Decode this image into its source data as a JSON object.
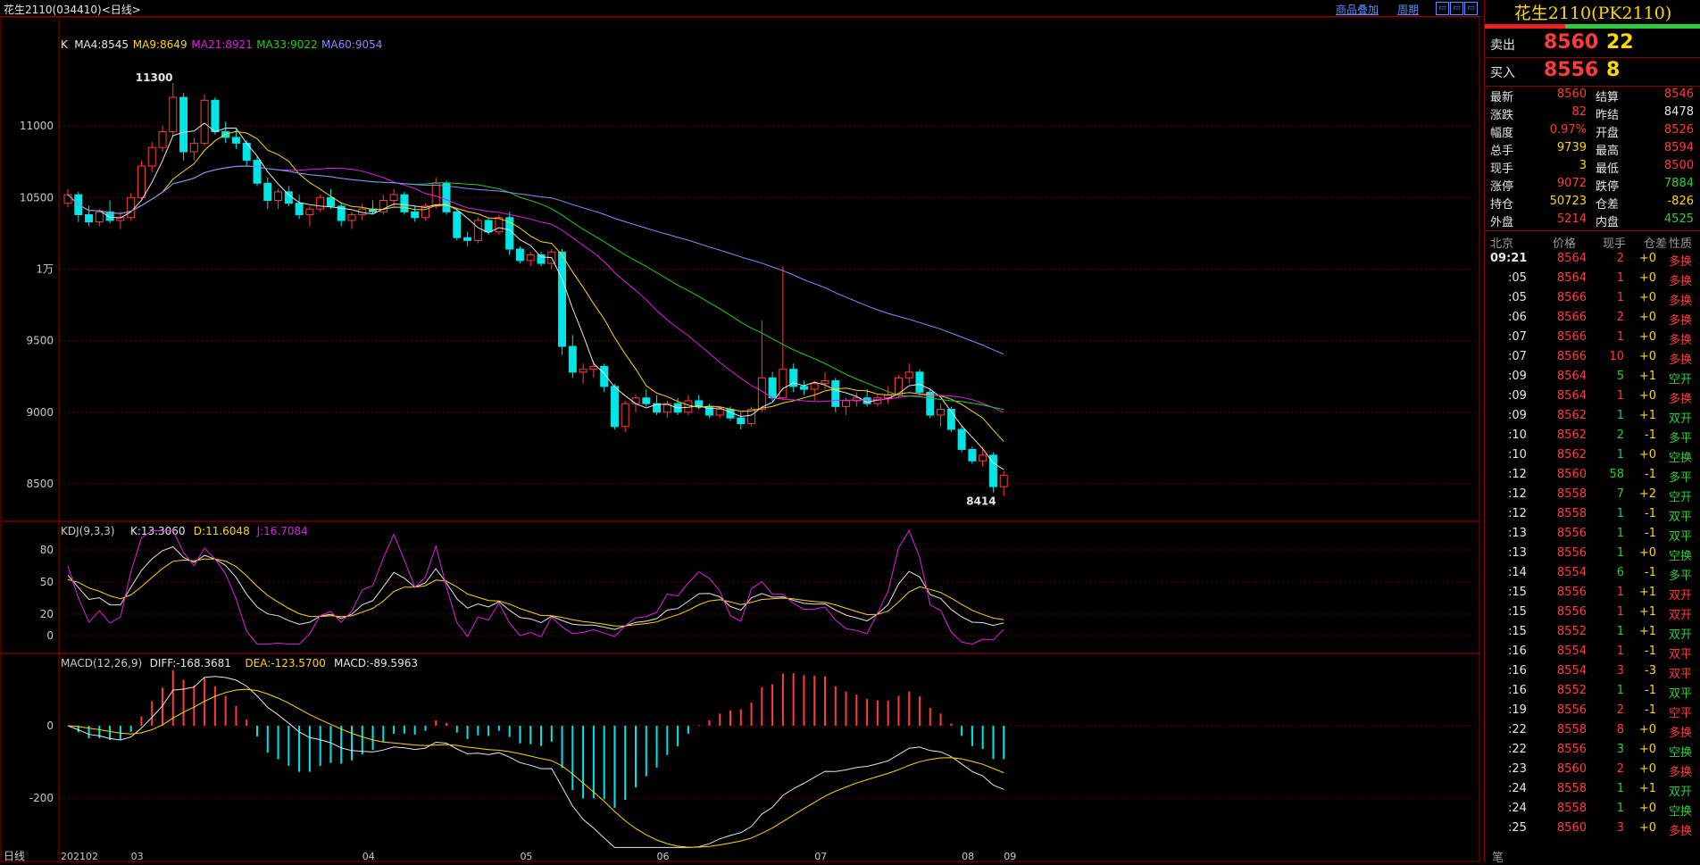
{
  "window": {
    "title": "花生2110(034410)<日线>",
    "links": {
      "overlay": "商品叠加",
      "period": "周期"
    },
    "win_buttons": [
      "▭",
      "▭",
      "▭"
    ]
  },
  "chart_data": {
    "type": "candlestick",
    "x_months": [
      "202102",
      "03",
      "04",
      "05",
      "06",
      "07",
      "08",
      "09"
    ],
    "bottom_label": "日线",
    "price_axis": {
      "ticks": [
        "11000",
        "10500",
        "1万",
        "9500",
        "9000",
        "8500"
      ],
      "range": [
        8300,
        11450
      ]
    },
    "ma_legend": [
      {
        "text": "K",
        "color": "#e6e6e6"
      },
      {
        "text": "MA4:8545",
        "color": "#e6e6e6"
      },
      {
        "text": "MA9:8649",
        "color": "#ffd700"
      },
      {
        "text": "MA21:8921",
        "color": "#e020e0"
      },
      {
        "text": "MA33:9022",
        "color": "#22cc22"
      },
      {
        "text": "MA60:9054",
        "color": "#8a8aff"
      }
    ],
    "high_mark": "11300",
    "low_mark": "8414",
    "candles": [
      [
        10460,
        10560,
        10430,
        10520
      ],
      [
        10520,
        10540,
        10330,
        10380
      ],
      [
        10380,
        10440,
        10300,
        10330
      ],
      [
        10330,
        10420,
        10300,
        10400
      ],
      [
        10400,
        10480,
        10320,
        10340
      ],
      [
        10340,
        10400,
        10280,
        10360
      ],
      [
        10360,
        10530,
        10340,
        10500
      ],
      [
        10500,
        10760,
        10480,
        10720
      ],
      [
        10720,
        10890,
        10680,
        10850
      ],
      [
        10850,
        11000,
        10820,
        10960
      ],
      [
        10960,
        11300,
        10930,
        11200
      ],
      [
        11200,
        11230,
        10760,
        10820
      ],
      [
        10820,
        10920,
        10760,
        10880
      ],
      [
        10880,
        11220,
        10860,
        11180
      ],
      [
        11180,
        11200,
        10940,
        10960
      ],
      [
        10960,
        11030,
        10880,
        10920
      ],
      [
        10920,
        10980,
        10840,
        10880
      ],
      [
        10880,
        10900,
        10720,
        10760
      ],
      [
        10760,
        10790,
        10580,
        10600
      ],
      [
        10600,
        10640,
        10420,
        10480
      ],
      [
        10480,
        10560,
        10420,
        10540
      ],
      [
        10540,
        10580,
        10440,
        10460
      ],
      [
        10460,
        10520,
        10350,
        10380
      ],
      [
        10380,
        10440,
        10300,
        10420
      ],
      [
        10420,
        10520,
        10400,
        10500
      ],
      [
        10500,
        10560,
        10420,
        10440
      ],
      [
        10440,
        10460,
        10300,
        10340
      ],
      [
        10340,
        10400,
        10280,
        10380
      ],
      [
        10380,
        10460,
        10340,
        10420
      ],
      [
        10420,
        10480,
        10380,
        10400
      ],
      [
        10400,
        10520,
        10380,
        10480
      ],
      [
        10480,
        10560,
        10440,
        10520
      ],
      [
        10520,
        10540,
        10380,
        10400
      ],
      [
        10400,
        10440,
        10330,
        10360
      ],
      [
        10360,
        10460,
        10340,
        10440
      ],
      [
        10440,
        10640,
        10420,
        10600
      ],
      [
        10600,
        10620,
        10380,
        10400
      ],
      [
        10400,
        10420,
        10200,
        10220
      ],
      [
        10220,
        10260,
        10160,
        10200
      ],
      [
        10200,
        10360,
        10180,
        10340
      ],
      [
        10340,
        10360,
        10240,
        10260
      ],
      [
        10260,
        10380,
        10240,
        10360
      ],
      [
        10360,
        10400,
        10100,
        10140
      ],
      [
        10140,
        10160,
        10040,
        10060
      ],
      [
        10060,
        10120,
        10020,
        10100
      ],
      [
        10100,
        10120,
        10020,
        10040
      ],
      [
        10040,
        10140,
        10000,
        10120
      ],
      [
        10120,
        10140,
        9400,
        9460
      ],
      [
        9460,
        9540,
        9240,
        9280
      ],
      [
        9280,
        9340,
        9200,
        9300
      ],
      [
        9300,
        9360,
        9240,
        9320
      ],
      [
        9320,
        9340,
        9140,
        9180
      ],
      [
        9180,
        9200,
        8880,
        8900
      ],
      [
        8900,
        9080,
        8860,
        9060
      ],
      [
        9060,
        9120,
        9000,
        9100
      ],
      [
        9100,
        9160,
        9040,
        9060
      ],
      [
        9060,
        9120,
        8980,
        9000
      ],
      [
        9000,
        9080,
        8960,
        9060
      ],
      [
        9060,
        9100,
        8980,
        9000
      ],
      [
        9000,
        9120,
        8980,
        9080
      ],
      [
        9080,
        9120,
        9020,
        9040
      ],
      [
        9040,
        9060,
        8960,
        8980
      ],
      [
        8980,
        9040,
        8960,
        9020
      ],
      [
        9020,
        9040,
        8940,
        8960
      ],
      [
        8960,
        9000,
        8880,
        8920
      ],
      [
        8920,
        9040,
        8900,
        9020
      ],
      [
        9020,
        9640,
        9000,
        9240
      ],
      [
        9240,
        9280,
        9080,
        9100
      ],
      [
        9100,
        10020,
        9080,
        9300
      ],
      [
        9300,
        9340,
        9140,
        9180
      ],
      [
        9180,
        9220,
        9120,
        9160
      ],
      [
        9160,
        9220,
        9080,
        9200
      ],
      [
        9200,
        9280,
        9160,
        9220
      ],
      [
        9220,
        9240,
        9000,
        9040
      ],
      [
        9040,
        9100,
        8980,
        9080
      ],
      [
        9080,
        9140,
        9040,
        9100
      ],
      [
        9100,
        9160,
        9040,
        9060
      ],
      [
        9060,
        9120,
        9040,
        9100
      ],
      [
        9100,
        9180,
        9060,
        9120
      ],
      [
        9120,
        9260,
        9100,
        9240
      ],
      [
        9240,
        9340,
        9200,
        9280
      ],
      [
        9280,
        9300,
        9120,
        9140
      ],
      [
        9140,
        9160,
        8960,
        8980
      ],
      [
        8980,
        9060,
        8900,
        9020
      ],
      [
        9020,
        9040,
        8860,
        8880
      ],
      [
        8880,
        8900,
        8720,
        8740
      ],
      [
        8740,
        8760,
        8640,
        8660
      ],
      [
        8660,
        8760,
        8620,
        8700
      ],
      [
        8700,
        8720,
        8440,
        8480
      ],
      [
        8480,
        8590,
        8414,
        8560
      ]
    ],
    "ma_values": {
      "MA4": 8545,
      "MA9": 8649,
      "MA21": 8921,
      "MA33": 9022,
      "MA60": 9054
    },
    "kdj": {
      "label": "KDJ(9,3,3)",
      "K": "K:13.3060",
      "D": "D:11.6048",
      "J": "J:16.7084",
      "ticks": [
        "80",
        "50",
        "20",
        "0"
      ],
      "range": [
        -10,
        100
      ]
    },
    "macd": {
      "label": "MACD(12,26,9)",
      "DIFF": "DIFF:-168.3681",
      "DEA": "DEA:-123.5700",
      "MACD": "MACD:-89.5963",
      "ticks": [
        "0",
        "-200"
      ],
      "range": [
        -340,
        180
      ]
    }
  },
  "panel": {
    "contract": "花生2110(PK2110)",
    "sell": {
      "label": "卖出",
      "price": "8560",
      "vol": "22"
    },
    "buy": {
      "label": "买入",
      "price": "8556",
      "vol": "8"
    },
    "stats": [
      {
        "l1": "最新",
        "v1": "8560",
        "c1": "red",
        "l2": "结算",
        "v2": "8546",
        "c2": "red"
      },
      {
        "l1": "涨跌",
        "v1": "82",
        "c1": "red",
        "l2": "昨结",
        "v2": "8478",
        "c2": "white"
      },
      {
        "l1": "幅度",
        "v1": "0.97%",
        "c1": "red",
        "l2": "开盘",
        "v2": "8526",
        "c2": "red"
      },
      {
        "l1": "总手",
        "v1": "9739",
        "c1": "yellow",
        "l2": "最高",
        "v2": "8594",
        "c2": "red"
      },
      {
        "l1": "现手",
        "v1": "3",
        "c1": "yellow",
        "l2": "最低",
        "v2": "8500",
        "c2": "red"
      },
      {
        "l1": "涨停",
        "v1": "9072",
        "c1": "red",
        "l2": "跌停",
        "v2": "7884",
        "c2": "green"
      },
      {
        "l1": "持仓",
        "v1": "50723",
        "c1": "yellow",
        "l2": "仓差",
        "v2": "-826",
        "c2": "yellow"
      },
      {
        "l1": "外盘",
        "v1": "5214",
        "c1": "red",
        "l2": "内盘",
        "v2": "4525",
        "c2": "green"
      }
    ],
    "ticks_header": [
      "北京",
      "价格",
      "现手",
      "仓差",
      "性质"
    ],
    "ticks": [
      {
        "t": "09:21",
        "p": "8564",
        "v": "2",
        "d": "+0",
        "n": "多换",
        "nc": "red",
        "vc": "red"
      },
      {
        "t": ":05",
        "p": "8564",
        "v": "1",
        "d": "+0",
        "n": "多换",
        "nc": "red",
        "vc": "red"
      },
      {
        "t": ":05",
        "p": "8566",
        "v": "1",
        "d": "+0",
        "n": "多换",
        "nc": "red",
        "vc": "red"
      },
      {
        "t": ":06",
        "p": "8566",
        "v": "2",
        "d": "+0",
        "n": "多换",
        "nc": "red",
        "vc": "red"
      },
      {
        "t": ":07",
        "p": "8566",
        "v": "1",
        "d": "+0",
        "n": "多换",
        "nc": "red",
        "vc": "red"
      },
      {
        "t": ":07",
        "p": "8566",
        "v": "10",
        "d": "+0",
        "n": "多换",
        "nc": "red",
        "vc": "red"
      },
      {
        "t": ":09",
        "p": "8564",
        "v": "5",
        "d": "+1",
        "n": "空开",
        "nc": "green",
        "vc": "green"
      },
      {
        "t": ":09",
        "p": "8564",
        "v": "1",
        "d": "+0",
        "n": "多换",
        "nc": "red",
        "vc": "red"
      },
      {
        "t": ":09",
        "p": "8562",
        "v": "1",
        "d": "+1",
        "n": "双开",
        "nc": "green",
        "vc": "green"
      },
      {
        "t": ":10",
        "p": "8562",
        "v": "2",
        "d": "-1",
        "n": "多平",
        "nc": "green",
        "vc": "green"
      },
      {
        "t": ":10",
        "p": "8562",
        "v": "1",
        "d": "+0",
        "n": "空换",
        "nc": "green",
        "vc": "green"
      },
      {
        "t": ":12",
        "p": "8560",
        "v": "58",
        "d": "-1",
        "n": "多平",
        "nc": "green",
        "vc": "green"
      },
      {
        "t": ":12",
        "p": "8558",
        "v": "7",
        "d": "+2",
        "n": "空开",
        "nc": "green",
        "vc": "green"
      },
      {
        "t": ":12",
        "p": "8558",
        "v": "1",
        "d": "-1",
        "n": "双平",
        "nc": "green",
        "vc": "green"
      },
      {
        "t": ":13",
        "p": "8556",
        "v": "1",
        "d": "-1",
        "n": "双平",
        "nc": "green",
        "vc": "green"
      },
      {
        "t": ":13",
        "p": "8556",
        "v": "1",
        "d": "+0",
        "n": "空换",
        "nc": "green",
        "vc": "green"
      },
      {
        "t": ":14",
        "p": "8554",
        "v": "6",
        "d": "-1",
        "n": "多平",
        "nc": "green",
        "vc": "green"
      },
      {
        "t": ":15",
        "p": "8556",
        "v": "1",
        "d": "+1",
        "n": "双开",
        "nc": "red",
        "vc": "red"
      },
      {
        "t": ":15",
        "p": "8556",
        "v": "1",
        "d": "+1",
        "n": "双开",
        "nc": "red",
        "vc": "red"
      },
      {
        "t": ":15",
        "p": "8552",
        "v": "1",
        "d": "+1",
        "n": "双开",
        "nc": "green",
        "vc": "green"
      },
      {
        "t": ":16",
        "p": "8554",
        "v": "1",
        "d": "-1",
        "n": "双平",
        "nc": "red",
        "vc": "red"
      },
      {
        "t": ":16",
        "p": "8554",
        "v": "3",
        "d": "-3",
        "n": "双平",
        "nc": "red",
        "vc": "red"
      },
      {
        "t": ":16",
        "p": "8552",
        "v": "1",
        "d": "-1",
        "n": "双平",
        "nc": "green",
        "vc": "green"
      },
      {
        "t": ":19",
        "p": "8556",
        "v": "2",
        "d": "-1",
        "n": "空平",
        "nc": "red",
        "vc": "red"
      },
      {
        "t": ":22",
        "p": "8558",
        "v": "8",
        "d": "+0",
        "n": "多换",
        "nc": "red",
        "vc": "red"
      },
      {
        "t": ":22",
        "p": "8556",
        "v": "3",
        "d": "+0",
        "n": "空换",
        "nc": "green",
        "vc": "green"
      },
      {
        "t": ":23",
        "p": "8560",
        "v": "2",
        "d": "+0",
        "n": "多换",
        "nc": "red",
        "vc": "red"
      },
      {
        "t": ":24",
        "p": "8558",
        "v": "1",
        "d": "+1",
        "n": "双开",
        "nc": "green",
        "vc": "green"
      },
      {
        "t": ":24",
        "p": "8558",
        "v": "1",
        "d": "+0",
        "n": "空换",
        "nc": "green",
        "vc": "green"
      },
      {
        "t": ":25",
        "p": "8560",
        "v": "3",
        "d": "+0",
        "n": "多换",
        "nc": "red",
        "vc": "red"
      }
    ],
    "footer": "笔"
  }
}
